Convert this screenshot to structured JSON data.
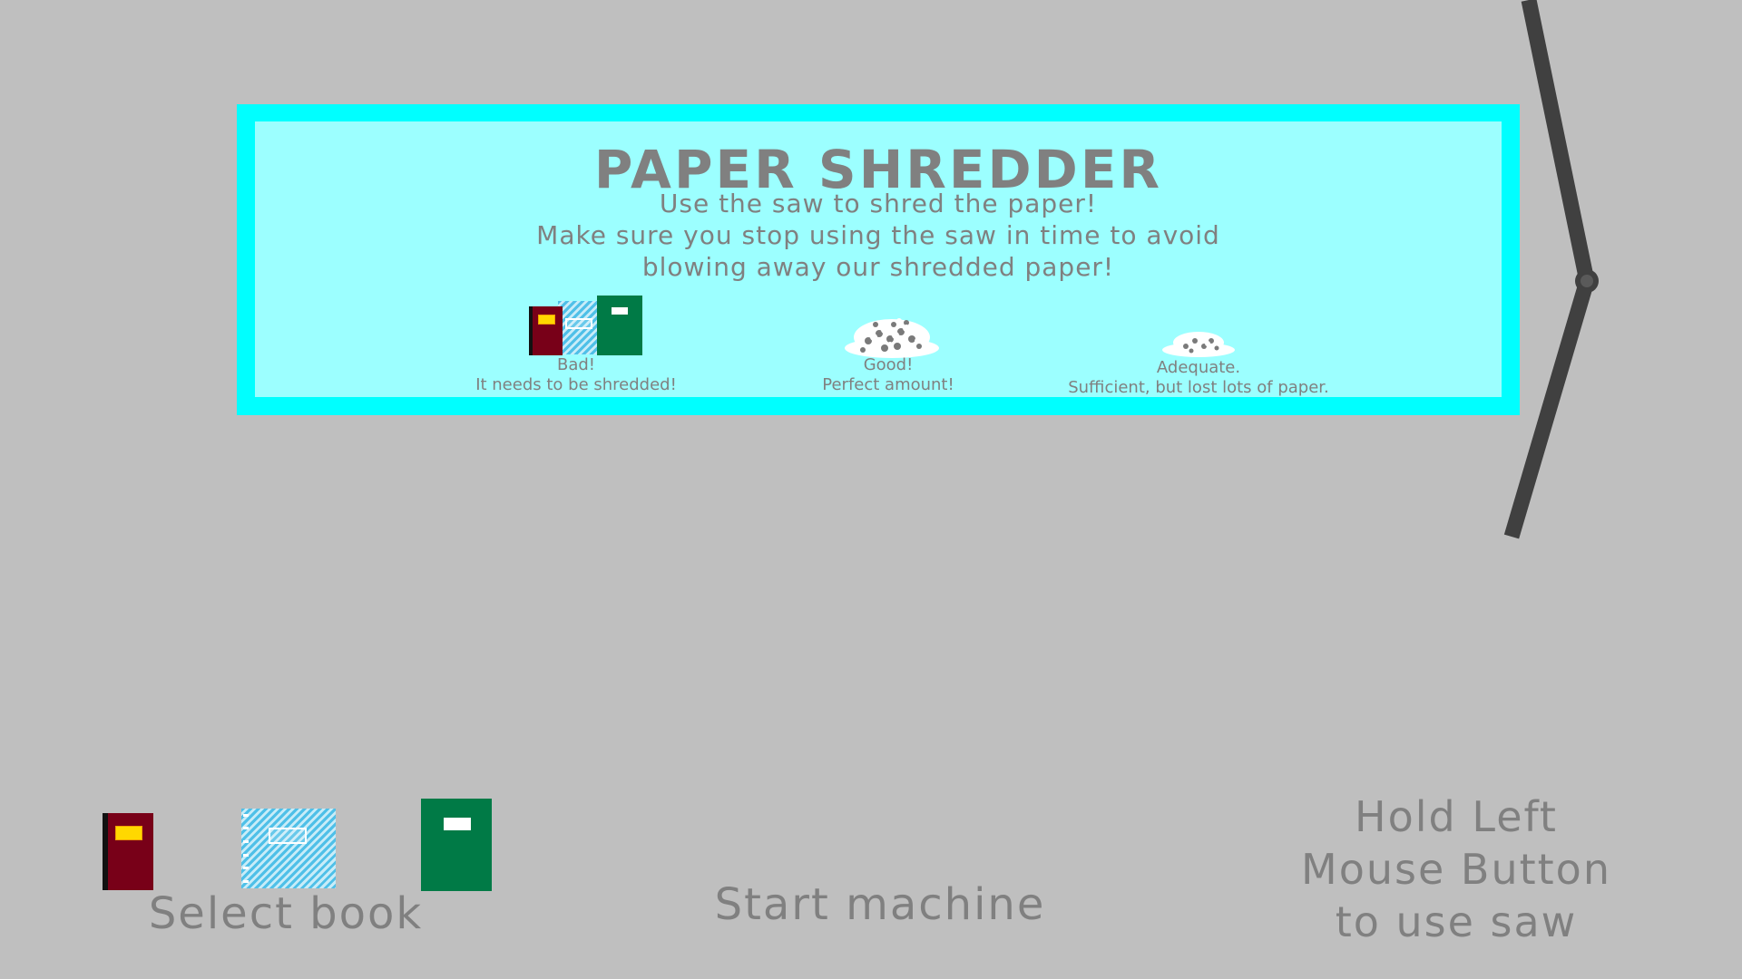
{
  "panel": {
    "title": "PAPER SHREDDER",
    "description": [
      "Use the saw to shred the paper!",
      "Make sure you stop using the saw in time to avoid",
      "blowing away our shredded paper!"
    ],
    "examples": [
      {
        "caption": "Bad!",
        "detail": "It needs to be shredded!",
        "icon": "books-icon"
      },
      {
        "caption": "Good!",
        "detail": "Perfect amount!",
        "icon": "paper-pile-large-icon"
      },
      {
        "caption": "Adequate.",
        "detail": "Sufficient, but lost lots of paper.",
        "icon": "paper-pile-small-icon"
      }
    ]
  },
  "books": [
    {
      "name": "red-book",
      "color": "#780018"
    },
    {
      "name": "blue-notebook",
      "color": "#4fc0e8"
    },
    {
      "name": "green-book",
      "color": "#007a46"
    }
  ],
  "controls": {
    "select_book": "Select book",
    "start_machine": "Start machine",
    "hint_lines": [
      "Hold Left",
      "Mouse Button",
      "to use saw"
    ]
  },
  "colors": {
    "background": "#bfbfbf",
    "panel_border": "#00ffff",
    "panel_fill": "#9cffff",
    "text": "#808080",
    "saw_arm": "#404040"
  }
}
